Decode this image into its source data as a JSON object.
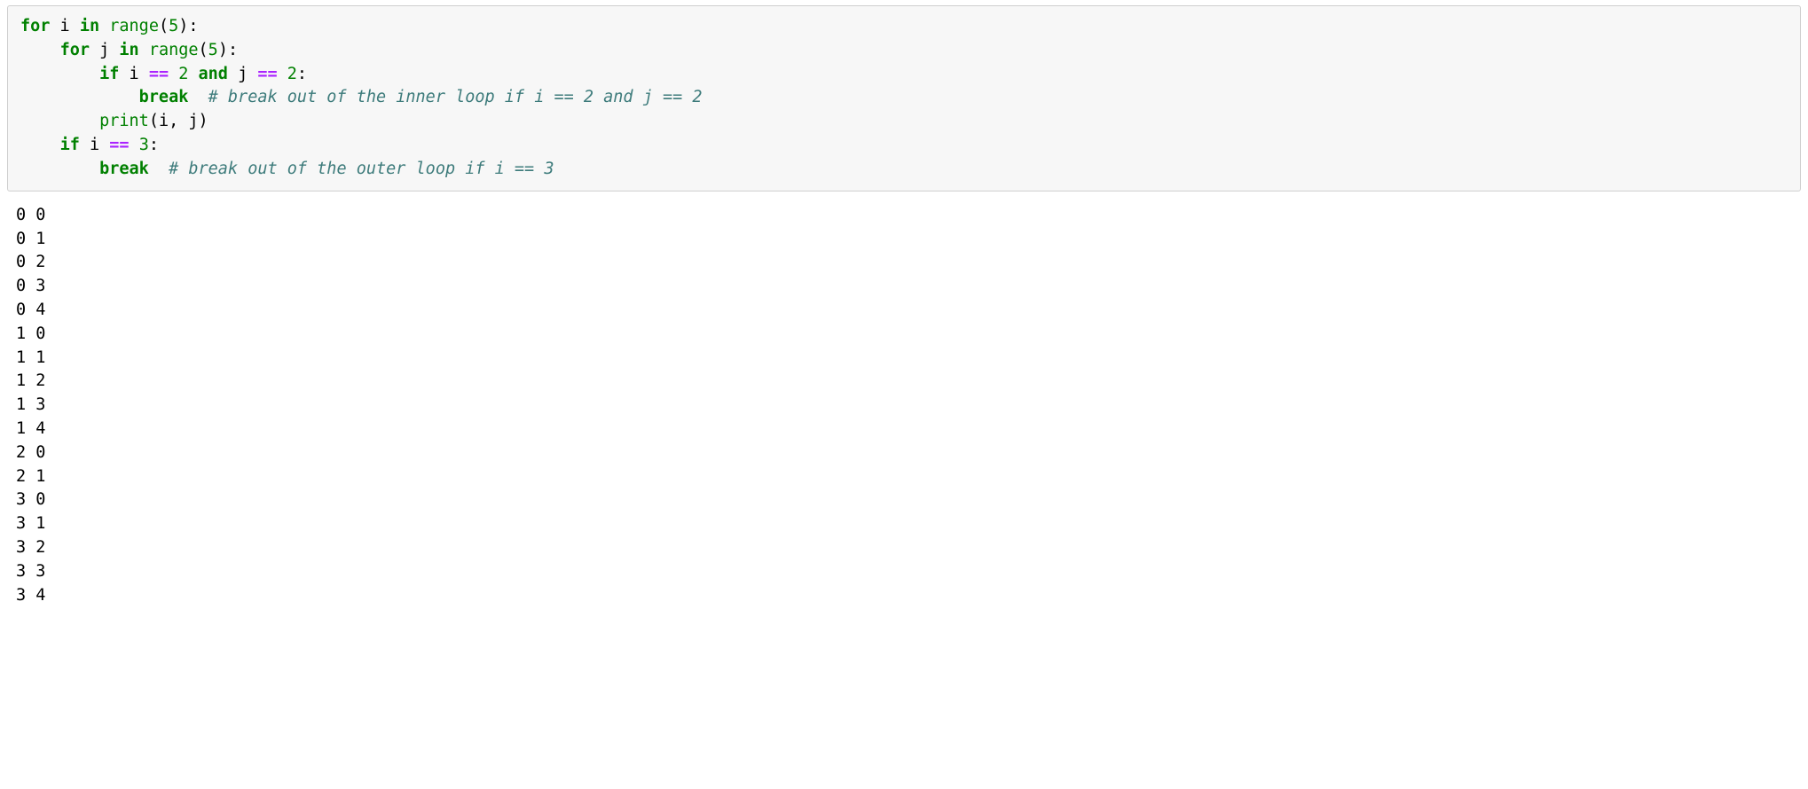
{
  "code": {
    "lines": [
      [
        {
          "cls": "kw",
          "t": "for"
        },
        {
          "cls": "name",
          "t": " i "
        },
        {
          "cls": "kwop",
          "t": "in"
        },
        {
          "cls": "name",
          "t": " "
        },
        {
          "cls": "builtin",
          "t": "range"
        },
        {
          "cls": "punct",
          "t": "("
        },
        {
          "cls": "num",
          "t": "5"
        },
        {
          "cls": "punct",
          "t": "):"
        }
      ],
      [
        {
          "cls": "name",
          "t": "    "
        },
        {
          "cls": "kw",
          "t": "for"
        },
        {
          "cls": "name",
          "t": " j "
        },
        {
          "cls": "kwop",
          "t": "in"
        },
        {
          "cls": "name",
          "t": " "
        },
        {
          "cls": "builtin",
          "t": "range"
        },
        {
          "cls": "punct",
          "t": "("
        },
        {
          "cls": "num",
          "t": "5"
        },
        {
          "cls": "punct",
          "t": "):"
        }
      ],
      [
        {
          "cls": "name",
          "t": "        "
        },
        {
          "cls": "kw",
          "t": "if"
        },
        {
          "cls": "name",
          "t": " i "
        },
        {
          "cls": "op",
          "t": "=="
        },
        {
          "cls": "name",
          "t": " "
        },
        {
          "cls": "num",
          "t": "2"
        },
        {
          "cls": "name",
          "t": " "
        },
        {
          "cls": "kwop",
          "t": "and"
        },
        {
          "cls": "name",
          "t": " j "
        },
        {
          "cls": "op",
          "t": "=="
        },
        {
          "cls": "name",
          "t": " "
        },
        {
          "cls": "num",
          "t": "2"
        },
        {
          "cls": "punct",
          "t": ":"
        }
      ],
      [
        {
          "cls": "name",
          "t": "            "
        },
        {
          "cls": "kw",
          "t": "break"
        },
        {
          "cls": "name",
          "t": "  "
        },
        {
          "cls": "comment",
          "t": "# break out of the inner loop if i == 2 and j == 2"
        }
      ],
      [
        {
          "cls": "name",
          "t": "        "
        },
        {
          "cls": "builtin",
          "t": "print"
        },
        {
          "cls": "punct",
          "t": "(i, j)"
        }
      ],
      [
        {
          "cls": "name",
          "t": "    "
        },
        {
          "cls": "kw",
          "t": "if"
        },
        {
          "cls": "name",
          "t": " i "
        },
        {
          "cls": "op",
          "t": "=="
        },
        {
          "cls": "name",
          "t": " "
        },
        {
          "cls": "num",
          "t": "3"
        },
        {
          "cls": "punct",
          "t": ":"
        }
      ],
      [
        {
          "cls": "name",
          "t": "        "
        },
        {
          "cls": "kw",
          "t": "break"
        },
        {
          "cls": "name",
          "t": "  "
        },
        {
          "cls": "comment",
          "t": "# break out of the outer loop if i == 3"
        }
      ]
    ]
  },
  "output_lines": [
    "0 0",
    "0 1",
    "0 2",
    "0 3",
    "0 4",
    "1 0",
    "1 1",
    "1 2",
    "1 3",
    "1 4",
    "2 0",
    "2 1",
    "3 0",
    "3 1",
    "3 2",
    "3 3",
    "3 4"
  ]
}
